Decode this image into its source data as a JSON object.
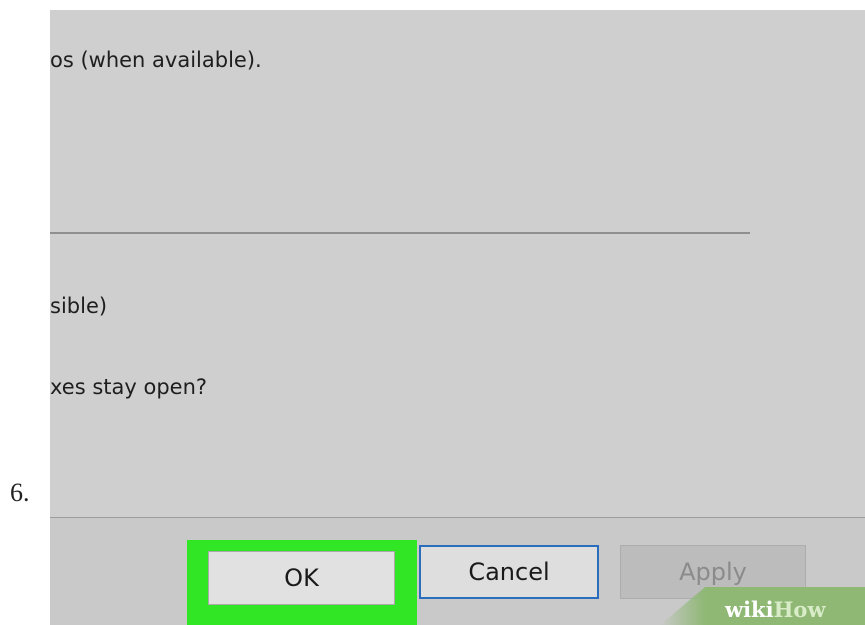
{
  "step": {
    "number": "6."
  },
  "dialog": {
    "lines": [
      "os (when available).",
      "sible)",
      "xes stay open?"
    ],
    "buttons": {
      "ok": "OK",
      "cancel": "Cancel",
      "apply": "Apply"
    }
  },
  "watermark": {
    "wiki": "wiki",
    "how": "How"
  },
  "colors": {
    "highlight": "#31e625",
    "focus_border": "#2a6dbd",
    "panel_bg": "#cfcfcf"
  }
}
